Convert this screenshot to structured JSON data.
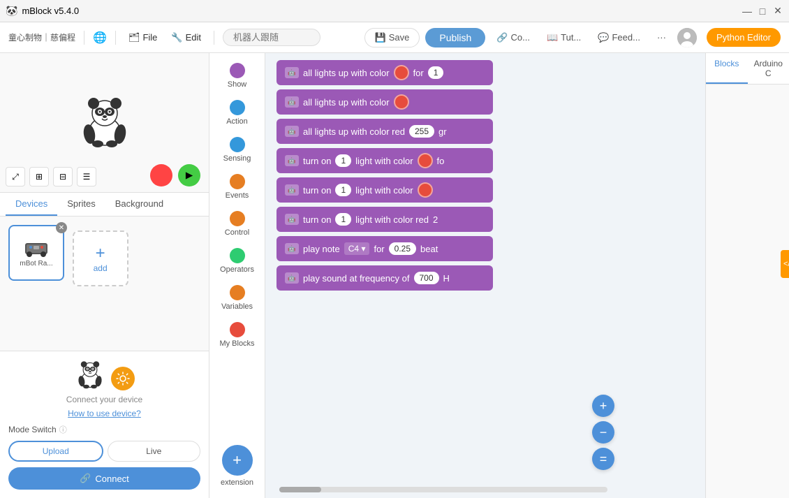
{
  "titlebar": {
    "title": "mBlock v5.4.0",
    "min": "—",
    "max": "□",
    "close": "✕"
  },
  "menubar": {
    "brand": "童心制物｜慈偏程",
    "file": "File",
    "edit": "Edit",
    "search_placeholder": "机器人跟随",
    "save": "Save",
    "publish": "Publish",
    "connect": "Co...",
    "tutorial": "Tut...",
    "feedback": "Feed...",
    "more": "···",
    "python_editor": "Python Editor"
  },
  "right_panel": {
    "tab_blocks": "Blocks",
    "tab_arduino": "Arduino C",
    "code_toggle": "</>"
  },
  "palette": {
    "items": [
      {
        "label": "Show",
        "color": "#9b59b6"
      },
      {
        "label": "Action",
        "color": "#3498db"
      },
      {
        "label": "Sensing",
        "color": "#3498db"
      },
      {
        "label": "Events",
        "color": "#e67e22"
      },
      {
        "label": "Control",
        "color": "#e67e22"
      },
      {
        "label": "Operators",
        "color": "#2ecc71"
      },
      {
        "label": "Variables",
        "color": "#e67e22"
      },
      {
        "label": "My Blocks",
        "color": "#e74c3c"
      }
    ],
    "extension_label": "extension"
  },
  "workspace": {
    "blocks": [
      {
        "id": "b1",
        "text_before": "all lights up with color",
        "has_color_circle": true,
        "color_circle": "red",
        "text_after": "for",
        "has_input": true,
        "input_val": "1"
      },
      {
        "id": "b2",
        "text_before": "all lights up with color",
        "has_color_circle": true,
        "color_circle": "red",
        "text_after": "",
        "has_input": false
      },
      {
        "id": "b3",
        "text_before": "all lights up with color red",
        "has_color_circle": false,
        "text_after": "",
        "has_input": true,
        "input_val": "255",
        "text_after2": "gr"
      },
      {
        "id": "b4",
        "text_before": "turn on",
        "has_num_input": true,
        "num_val": "1",
        "text_mid": "light with color",
        "has_color_circle": true,
        "color_circle": "red",
        "text_after": "fo",
        "has_input": false
      },
      {
        "id": "b5",
        "text_before": "turn on",
        "has_num_input": true,
        "num_val": "1",
        "text_mid": "light with color",
        "has_color_circle": true,
        "color_circle": "red",
        "text_after": "",
        "has_input": false
      },
      {
        "id": "b6",
        "text_before": "turn on",
        "has_num_input": true,
        "num_val": "1",
        "text_mid": "light with color red",
        "has_color_circle": false,
        "text_after": "2",
        "has_input": false
      },
      {
        "id": "b7",
        "text_before": "play note",
        "has_dropdown": true,
        "dropdown_val": "C4",
        "text_mid": "for",
        "has_input": true,
        "input_val": "0.25",
        "text_after": "beat"
      },
      {
        "id": "b8",
        "text_before": "play sound at frequency of",
        "has_input": true,
        "input_val": "700",
        "text_after": "H"
      }
    ]
  },
  "left_panel": {
    "tabs": [
      "Devices",
      "Sprites",
      "Background"
    ],
    "active_tab": "Devices",
    "device_label": "mBot Ra...",
    "add_label": "add",
    "panda_alt": "panda mascot",
    "connect_msg": "Connect your device",
    "how_to": "How to use device?",
    "mode_switch": "Mode Switch",
    "upload_label": "Upload",
    "live_label": "Live",
    "connect_btn": "Connect"
  },
  "zoom": {
    "zoom_in": "+",
    "zoom_out": "−",
    "zoom_reset": "="
  }
}
